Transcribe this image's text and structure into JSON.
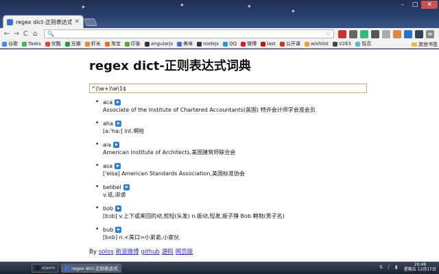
{
  "window": {
    "tab_title": "regex dict-正则表达式词典",
    "min_glyph": "–",
    "max_glyph": "□",
    "close_glyph": "✕"
  },
  "toolbar": {
    "back_glyph": "←",
    "forward_glyph": "→",
    "reload_glyph": "C",
    "home_glyph": "⌂",
    "url": "",
    "star_glyph": "☆"
  },
  "bookmarks": {
    "items": [
      {
        "label": "谷歌",
        "color": "#4285f4"
      },
      {
        "label": "Tasks",
        "color": "#3cba54"
      },
      {
        "label": "优酷",
        "color": "#e23d3d"
      },
      {
        "label": "豆瓣",
        "color": "#2e963d"
      },
      {
        "label": "虾米",
        "color": "#f08a24"
      },
      {
        "label": "淘宝",
        "color": "#f26b1d"
      },
      {
        "label": "印象",
        "color": "#5aa532"
      },
      {
        "label": "angularjs",
        "color": "#333333"
      },
      {
        "label": "美味",
        "color": "#3a6fd8"
      },
      {
        "label": "nodejs",
        "color": "#333333"
      },
      {
        "label": "QQ",
        "color": "#1b9be0"
      },
      {
        "label": "微博",
        "color": "#e6162d"
      },
      {
        "label": "last",
        "color": "#d51007"
      },
      {
        "label": "公开课",
        "color": "#c0392b"
      },
      {
        "label": "wishlist",
        "color": "#f0a030"
      },
      {
        "label": "V2EX",
        "color": "#444444"
      },
      {
        "label": "饭否",
        "color": "#58b7d8"
      }
    ],
    "other_label": "其他书签"
  },
  "page": {
    "heading": "regex dict-正则表达式词典",
    "query_value": "^(\\w+)\\w\\1$",
    "results": [
      {
        "word": "aca",
        "definition": "Associate of the Institute of Chartered Accountants(英国) 特许会计师学会准会员"
      },
      {
        "word": "aha",
        "definition": "[a:'ha:] int.啊哈"
      },
      {
        "word": "aia",
        "definition": "American Institute of Architects,美国建筑师联合会"
      },
      {
        "word": "asa",
        "definition": "['eisa] American Standards Association,美国标准协会"
      },
      {
        "word": "belibel",
        "definition": "v.诋,诽谤"
      },
      {
        "word": "bob",
        "definition": "[bɔb] v.上下或来回的动,剪短(头发) n.振动,短发,振子锤 Bob 鲍勃(男子名)"
      },
      {
        "word": "bub",
        "definition": "[bʌb] n.<美口>小弟弟,小家伙"
      }
    ],
    "footer": {
      "prefix": "By",
      "links": [
        "solos",
        "新浪微博",
        "github",
        "源码",
        "网页版"
      ]
    }
  },
  "taskbar": {
    "tasks": [
      {
        "label": "xterm",
        "color": "#222222"
      },
      {
        "label": "regex dict-正则表达式",
        "color": "#3a6fd8"
      }
    ],
    "clock_time": "20:48",
    "clock_date": "星期五 12月17日"
  }
}
